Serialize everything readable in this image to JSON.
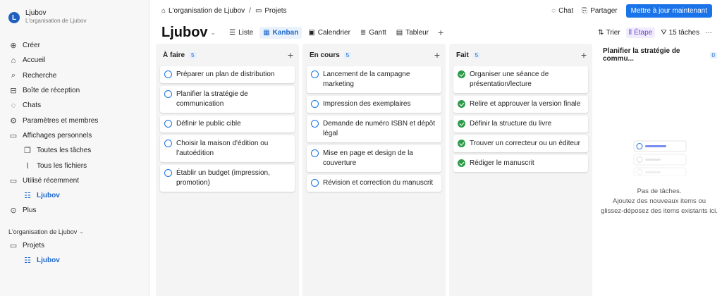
{
  "workspace": {
    "avatar_letter": "L",
    "name": "Ljubov",
    "subtitle": "L'organisation de Ljubov"
  },
  "sidebar": {
    "items": [
      {
        "label": "Créer",
        "icon": "plus-circle-icon",
        "glyph": "⊕"
      },
      {
        "label": "Accueil",
        "icon": "home-icon",
        "glyph": "⌂"
      },
      {
        "label": "Recherche",
        "icon": "search-icon",
        "glyph": "⌕"
      },
      {
        "label": "Boîte de réception",
        "icon": "inbox-icon",
        "glyph": "⊟"
      },
      {
        "label": "Chats",
        "icon": "chat-icon",
        "glyph": "◌"
      },
      {
        "label": "Paramètres et membres",
        "icon": "gear-icon",
        "glyph": "⚙"
      },
      {
        "label": "Affichages personnels",
        "icon": "folder-icon",
        "glyph": "▭"
      },
      {
        "label": "Toutes les tâches",
        "icon": "tasks-icon",
        "glyph": "❐"
      },
      {
        "label": "Tous les fichiers",
        "icon": "paperclip-icon",
        "glyph": "⌇"
      },
      {
        "label": "Utilisé récemment",
        "icon": "recent-folder-icon",
        "glyph": "▭"
      },
      {
        "label": "Ljubov",
        "icon": "board-icon",
        "glyph": "☷"
      },
      {
        "label": "Plus",
        "icon": "more-circle-icon",
        "glyph": "⊙"
      }
    ],
    "org_label": "L'organisation de Ljubov",
    "org_items": [
      {
        "label": "Projets",
        "icon": "folder-icon",
        "glyph": "▭"
      },
      {
        "label": "Ljubov",
        "icon": "board-icon",
        "glyph": "☷"
      }
    ]
  },
  "topbar": {
    "breadcrumb_org": "L'organisation de Ljubov",
    "breadcrumb_sep": "/",
    "breadcrumb_folder": "Projets",
    "chat": "Chat",
    "share": "Partager",
    "update_button": "Mettre à jour maintenant"
  },
  "viewbar": {
    "title": "Ljubov",
    "tabs": [
      {
        "label": "Liste",
        "glyph": "☰",
        "icon": "list-icon"
      },
      {
        "label": "Kanban",
        "glyph": "▦",
        "icon": "kanban-icon"
      },
      {
        "label": "Calendrier",
        "glyph": "▣",
        "icon": "calendar-icon"
      },
      {
        "label": "Gantt",
        "glyph": "≣",
        "icon": "gantt-icon"
      },
      {
        "label": "Tableur",
        "glyph": "▤",
        "icon": "table-icon"
      }
    ],
    "add_view": "+",
    "sort": "Trier",
    "group": "Étape",
    "filter": "15 tâches",
    "more": "···"
  },
  "columns": [
    {
      "title": "À faire",
      "count": "5",
      "cards": [
        {
          "text": "Préparer un plan de distribution",
          "done": false
        },
        {
          "text": "Planifier la stratégie de communication",
          "done": false
        },
        {
          "text": "Définir le public cible",
          "done": false
        },
        {
          "text": "Choisir la maison d'édition ou l'autoédition",
          "done": false
        },
        {
          "text": "Établir un budget (impression, promotion)",
          "done": false
        }
      ]
    },
    {
      "title": "En cours",
      "count": "5",
      "cards": [
        {
          "text": "Lancement de la campagne marketing",
          "done": false
        },
        {
          "text": "Impression des exemplaires",
          "done": false
        },
        {
          "text": "Demande de numéro ISBN et dépôt légal",
          "done": false
        },
        {
          "text": "Mise en page et design de la couverture",
          "done": false
        },
        {
          "text": "Révision et correction du manuscrit",
          "done": false
        }
      ]
    },
    {
      "title": "Fait",
      "count": "5",
      "cards": [
        {
          "text": "Organiser une séance de présentation/lecture",
          "done": true
        },
        {
          "text": "Relire et approuver la version finale",
          "done": true
        },
        {
          "text": "Définir la structure du livre",
          "done": true
        },
        {
          "text": "Trouver un correcteur ou un éditeur",
          "done": true
        },
        {
          "text": "Rédiger le manuscrit",
          "done": true
        }
      ]
    }
  ],
  "empty_column": {
    "title": "Planifier la stratégie de commu...",
    "count": "0",
    "empty_title": "Pas de tâches.",
    "empty_line1": "Ajoutez des nouveaux items ou",
    "empty_line2": "glissez-déposez des items existants ici."
  },
  "colors": {
    "accent": "#1a73e8",
    "done": "#2e9b4a",
    "group_accent": "#6b3fd3"
  }
}
